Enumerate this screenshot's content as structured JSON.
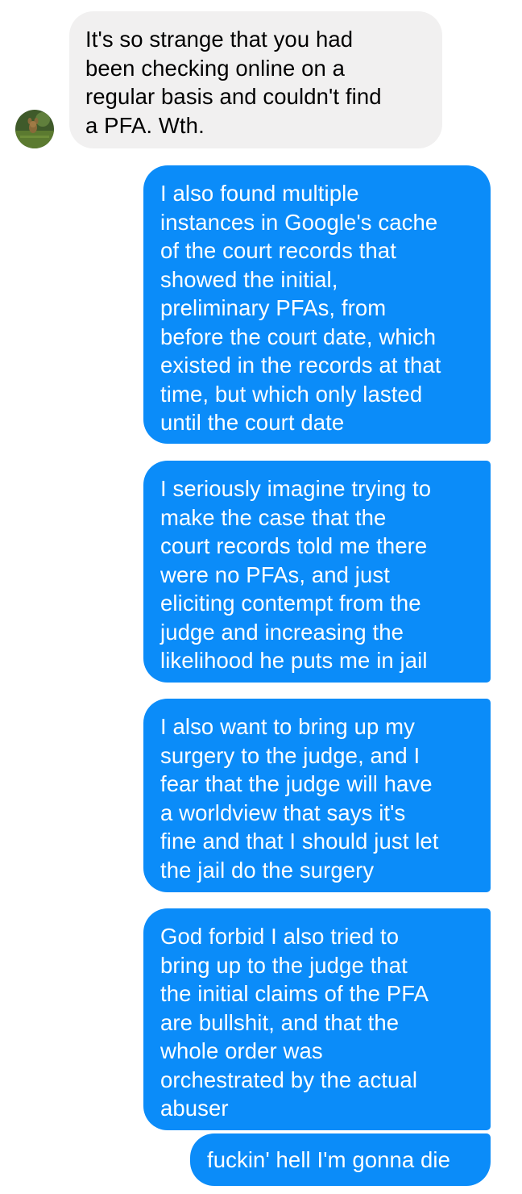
{
  "conversation": {
    "contact_avatar_icon": "contact-avatar-photo",
    "colors": {
      "incoming_bubble": "#f1f0f0",
      "outgoing_bubble": "#0b8cf9",
      "incoming_text": "#000000",
      "outgoing_text": "#ffffff"
    },
    "messages": [
      {
        "sender": "contact",
        "text": "It's so strange that you had\nbeen checking online on a\nregular basis and couldn't find\na PFA. Wth."
      },
      {
        "sender": "me",
        "text": "I also found multiple\ninstances in Google's cache\nof the court records that\nshowed the initial,\npreliminary PFAs, from\nbefore the court date, which\nexisted in the records at that\ntime, but which only lasted\nuntil the court date"
      },
      {
        "sender": "me",
        "text": "I seriously imagine trying to\nmake the case that the\ncourt records told me there\nwere no PFAs, and just\neliciting contempt from the\njudge and increasing the\nlikelihood he puts me in jail"
      },
      {
        "sender": "me",
        "text": "I also want to bring up my\nsurgery to the judge, and I\nfear that the judge will have\na worldview that says it's\nfine and that I should just let\nthe jail do the surgery"
      },
      {
        "sender": "me",
        "text": "God forbid I also tried to\nbring up to the judge that\nthe initial claims of the PFA\nare bullshit, and that the\nwhole order was\norchestrated by the actual\nabuser"
      },
      {
        "sender": "me",
        "text": "fuckin' hell I'm gonna die"
      }
    ]
  }
}
